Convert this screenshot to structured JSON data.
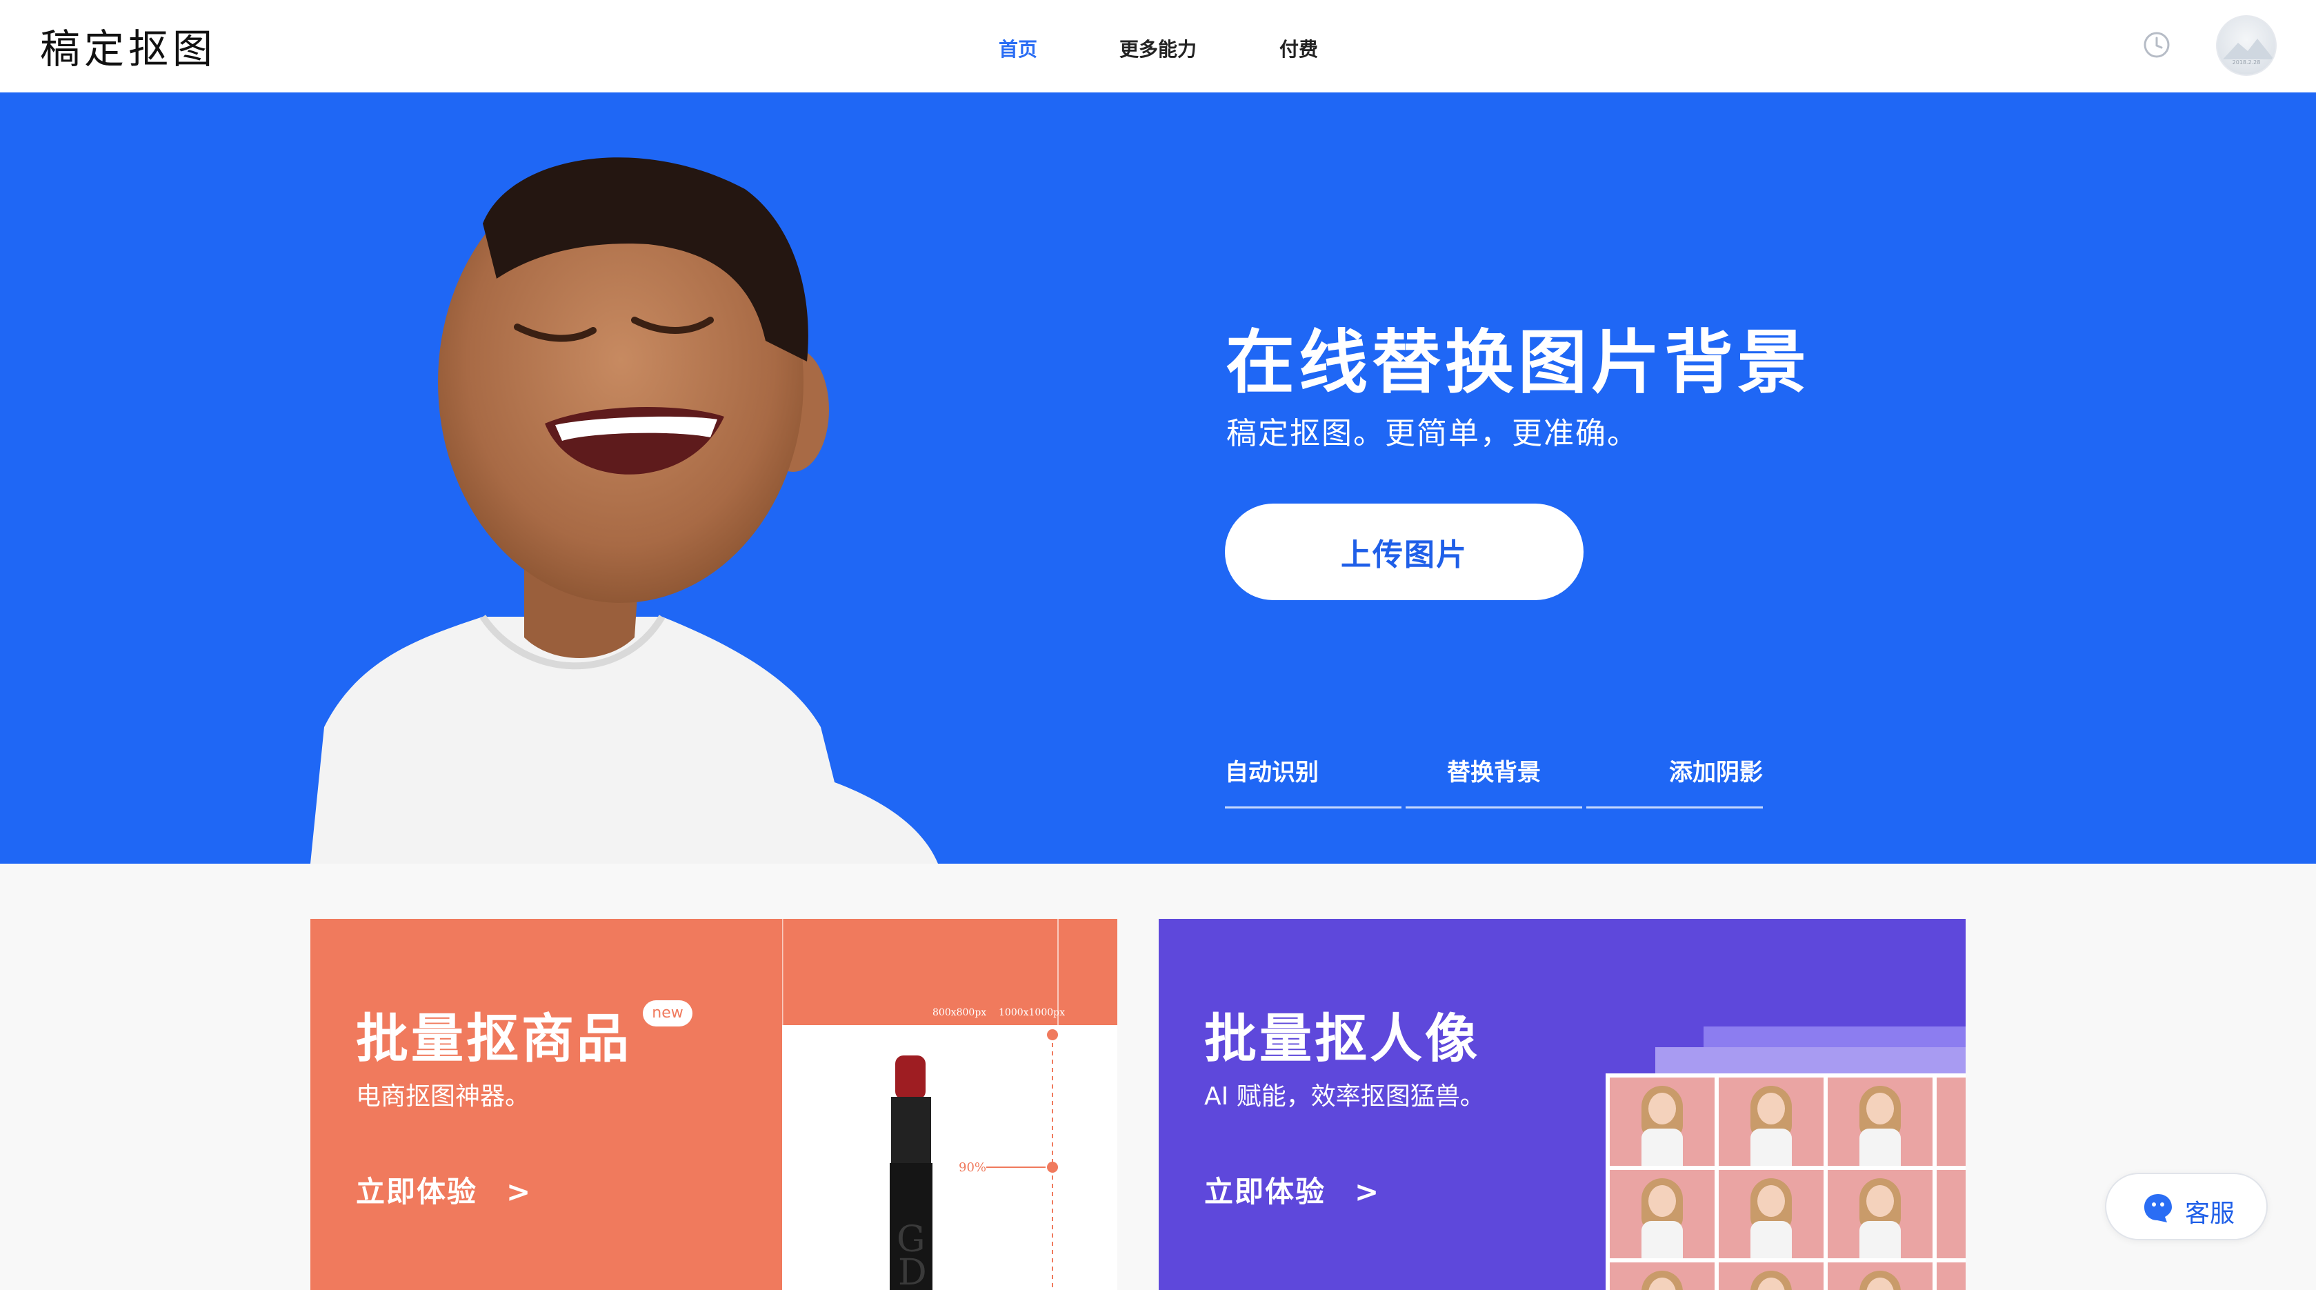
{
  "header": {
    "logo": "稿定抠图",
    "nav": [
      {
        "label": "首页",
        "active": true
      },
      {
        "label": "更多能力",
        "active": false
      },
      {
        "label": "付费",
        "active": false
      }
    ],
    "history_icon": "clock-icon",
    "avatar_text": "2018.2.28"
  },
  "hero": {
    "title": "在线替换图片背景",
    "subtitle": "稿定抠图。更简单，更准确。",
    "upload_label": "上传图片",
    "tabs": [
      "自动识别",
      "替换背景",
      "添加阴影"
    ],
    "background_color": "#1f67f5"
  },
  "cards": [
    {
      "title": "批量抠商品",
      "badge": "new",
      "description": "电商抠图神器。",
      "cta": "立即体验",
      "arrow": ">",
      "color": "#f07a5d",
      "annotations": [
        "800x800px",
        "1000x1000px",
        "90%"
      ]
    },
    {
      "title": "批量抠人像",
      "description": "AI 赋能，效率抠图猛兽。",
      "cta": "立即体验",
      "arrow": ">",
      "color": "#5e48db"
    }
  ],
  "service": {
    "label": "客服",
    "icon": "chat-bubble-icon"
  }
}
